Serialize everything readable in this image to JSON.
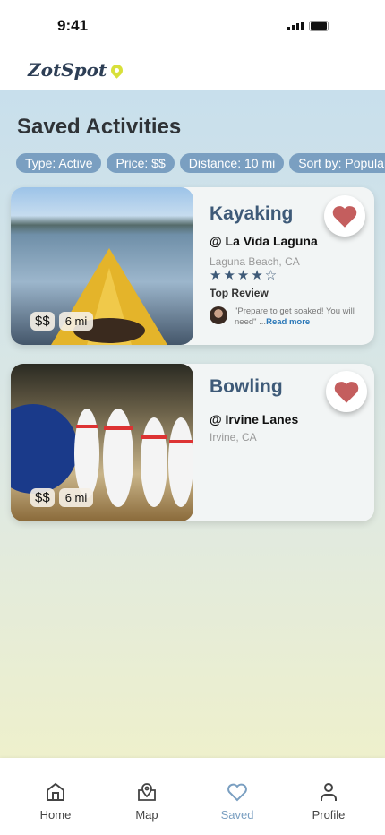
{
  "status": {
    "time": "9:41"
  },
  "app": {
    "logo": "ZotSpot"
  },
  "page": {
    "title": "Saved Activities"
  },
  "filters": [
    "Type: Active",
    "Price: $$",
    "Distance: 10 mi",
    "Sort by: Popular"
  ],
  "activities": [
    {
      "title": "Kayaking",
      "venue": "@ La Vida Laguna",
      "location": "Laguna Beach, CA",
      "rating": 4,
      "rating_text": "★★★★☆",
      "top_review_label": "Top Review",
      "review": "\"Prepare to get soaked! You will need\" ...",
      "read_more": "Read more",
      "price": "$$",
      "distance": "6 mi",
      "saved": true
    },
    {
      "title": "Bowling",
      "venue": "@ Irvine Lanes",
      "location": "Irvine, CA",
      "price": "$$",
      "distance": "6 mi",
      "saved": true
    }
  ],
  "nav": [
    {
      "label": "Home"
    },
    {
      "label": "Map"
    },
    {
      "label": "Saved",
      "active": true
    },
    {
      "label": "Profile"
    }
  ],
  "colors": {
    "accent": "#7a9fc1",
    "heart": "#c45e5e",
    "title": "#3e5a78"
  }
}
